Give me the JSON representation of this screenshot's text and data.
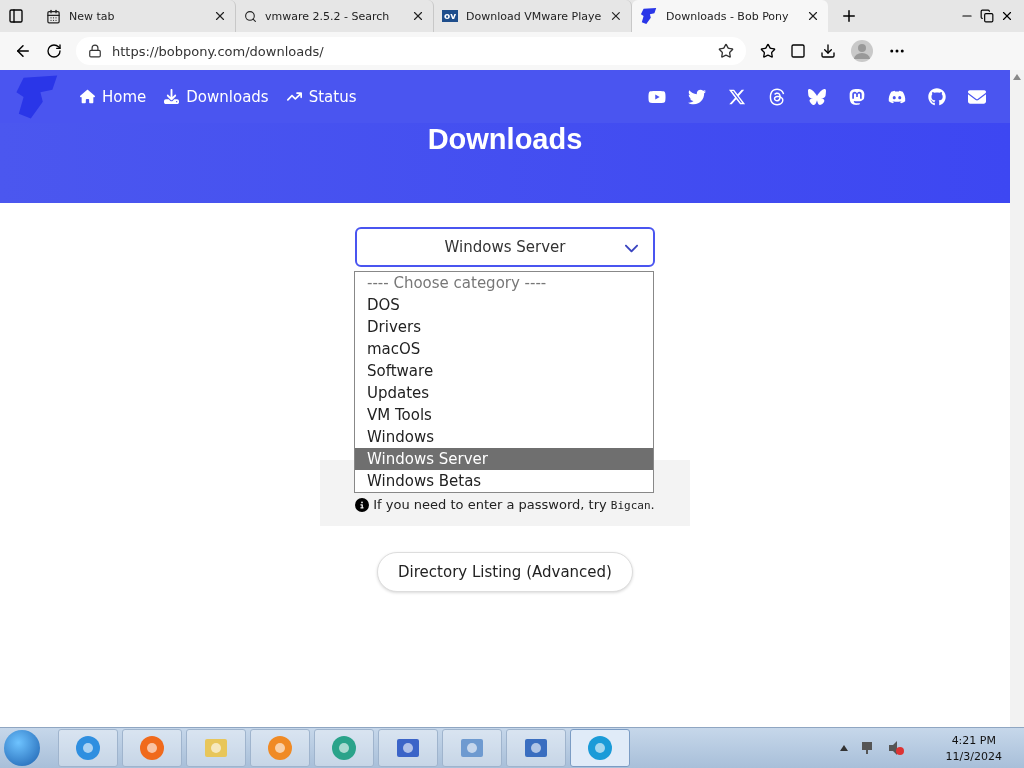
{
  "browser": {
    "tabs": [
      {
        "title": "New tab",
        "kind": "newtab",
        "selected": false
      },
      {
        "title": "vmware 2.5.2 - Search",
        "kind": "search",
        "selected": false
      },
      {
        "title": "Download VMware Playe",
        "kind": "ov",
        "favicon_text": "ov",
        "selected": false
      },
      {
        "title": "Downloads - Bob Pony",
        "kind": "site",
        "selected": true
      }
    ],
    "address": "https://bobpony.com/downloads/"
  },
  "site": {
    "nav": [
      {
        "label": "Home",
        "kind": "home"
      },
      {
        "label": "Downloads",
        "kind": "download"
      },
      {
        "label": "Status",
        "kind": "status"
      }
    ],
    "social": [
      {
        "kind": "youtube"
      },
      {
        "kind": "twitter"
      },
      {
        "kind": "x"
      },
      {
        "kind": "threads"
      },
      {
        "kind": "bluesky"
      },
      {
        "kind": "mastodon"
      },
      {
        "kind": "discord"
      },
      {
        "kind": "github"
      },
      {
        "kind": "email"
      }
    ],
    "heading": "Downloads",
    "category_select": {
      "value": "Windows Server",
      "expanded": true,
      "options": [
        {
          "label": "---- Choose category ----",
          "selected": false,
          "kind": "placeholder"
        },
        {
          "label": "DOS",
          "selected": false,
          "kind": "option"
        },
        {
          "label": "Drivers",
          "selected": false,
          "kind": "option"
        },
        {
          "label": "macOS",
          "selected": false,
          "kind": "option"
        },
        {
          "label": "Software",
          "selected": false,
          "kind": "option"
        },
        {
          "label": "Updates",
          "selected": false,
          "kind": "option"
        },
        {
          "label": "VM Tools",
          "selected": false,
          "kind": "option"
        },
        {
          "label": "Windows",
          "selected": false,
          "kind": "option"
        },
        {
          "label": "Windows Server",
          "selected": true,
          "kind": "option"
        },
        {
          "label": "Windows Betas",
          "selected": false,
          "kind": "option"
        }
      ]
    },
    "notice": "If you need to enter a password, try ",
    "notice_code": "Bigcan",
    "notice_end": ".",
    "directory_button": "Directory Listing (Advanced)"
  },
  "taskbar": {
    "apps": [
      {
        "kind": "ie",
        "selected": false
      },
      {
        "kind": "firefox",
        "selected": false
      },
      {
        "kind": "explorer",
        "selected": false
      },
      {
        "kind": "media",
        "selected": false
      },
      {
        "kind": "app",
        "selected": false
      },
      {
        "kind": "tools",
        "selected": false
      },
      {
        "kind": "control",
        "selected": false
      },
      {
        "kind": "network",
        "selected": false
      },
      {
        "kind": "edge",
        "selected": true
      }
    ],
    "time": "4:21 PM",
    "date": "11/3/2024"
  }
}
